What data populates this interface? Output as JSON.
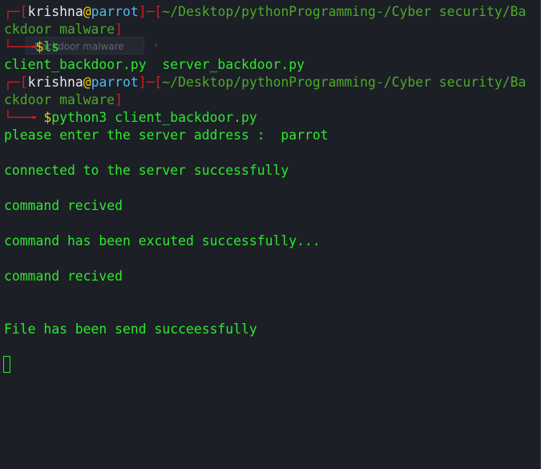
{
  "prompt1": {
    "corner": "┌─",
    "open_bracket": "[",
    "user": "krishna",
    "at": "@",
    "host": "parrot",
    "close_bracket": "]",
    "dash": "─",
    "path_open": "[",
    "path_line1": "~/Desktop/pythonProgramming-/Cyber security/Ba",
    "path_line2": "ckdoor malware",
    "path_close": "]",
    "arrow": "└──╼",
    "dollar": "$",
    "command": "ls"
  },
  "ls_output": "client_backdoor.py  server_backdoor.py",
  "prompt2": {
    "corner": "┌─",
    "open_bracket": "[",
    "user": "krishna",
    "at": "@",
    "host": "parrot",
    "close_bracket": "]",
    "dash": "─",
    "path_open": "[",
    "path_line1": "~/Desktop/pythonProgramming-/Cyber security/Ba",
    "path_line2": "ckdoor malware",
    "path_close": "]",
    "arrow": "└──╼ ",
    "dollar": "$",
    "command": "python3 client_backdoor.py"
  },
  "output": [
    "please enter the server address :  parrot",
    "connected to the server successfully",
    "command recived",
    "command has been excuted successfully...",
    "command recived",
    "File has been send succeessfully"
  ],
  "tooltip": {
    "text": "Backdoor malware",
    "arrow": "›"
  },
  "colors": {
    "background": "#1c1f26",
    "prompt_red": "#d81b1b",
    "host_blue": "#4fb8e8",
    "at_yellow": "#f0d000",
    "path_green": "#4caa28",
    "output_green": "#2ee82e"
  }
}
